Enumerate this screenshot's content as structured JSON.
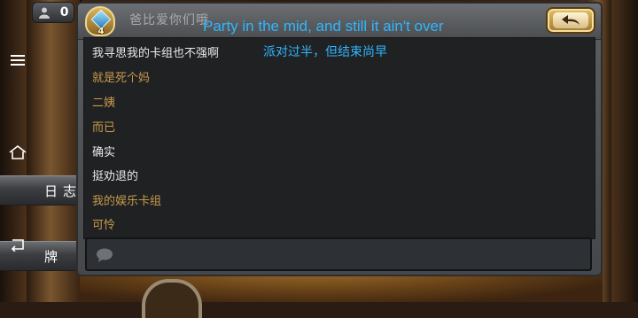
{
  "status": {
    "count": "0"
  },
  "side_tabs": {
    "log": "日志",
    "deck": "牌"
  },
  "chat": {
    "friend_name": "爸比爱你们哦",
    "friend_level": "4",
    "messages": [
      {
        "text": "我寻思我的卡组也不强啊",
        "from": "mine"
      },
      {
        "text": "就是死个妈",
        "from": "theirs"
      },
      {
        "text": "二姨",
        "from": "theirs"
      },
      {
        "text": "而已",
        "from": "theirs"
      },
      {
        "text": "确实",
        "from": "mine"
      },
      {
        "text": "挺劝退的",
        "from": "mine"
      },
      {
        "text": "我的娱乐卡组",
        "from": "theirs"
      },
      {
        "text": "可怜",
        "from": "theirs"
      }
    ],
    "input_value": ""
  },
  "subtitles": {
    "english": "Party in the mid, and still it ain't over",
    "chinese": "派对过半，但结束尚早"
  },
  "colors": {
    "my_message": "#e8e8e8",
    "their_message": "#c79a4a",
    "subtitle": "#2fb6ff"
  },
  "icons": {
    "nav_menu": "menu-icon",
    "nav_home": "home-icon",
    "nav_back": "back-icon",
    "status": "friends-icon",
    "header_back": "back-arrow-icon",
    "input": "speech-bubble-icon"
  }
}
